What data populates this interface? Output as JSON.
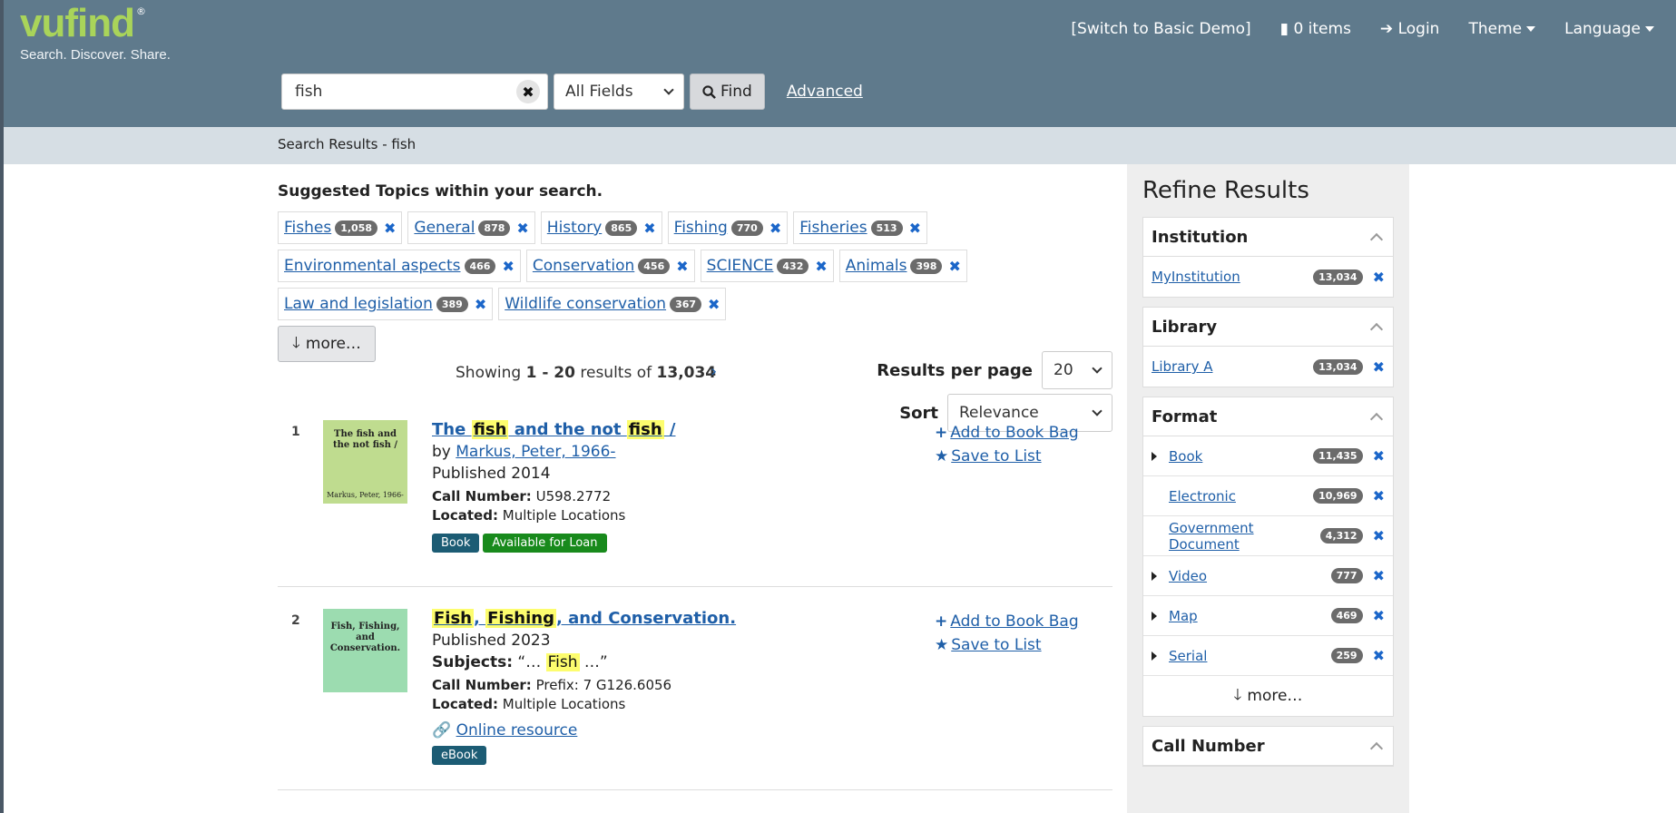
{
  "brand": {
    "logo": "vufind",
    "registered": "®",
    "tagline": "Search. Discover. Share."
  },
  "topnav": {
    "switch_demo": "[Switch to Basic Demo]",
    "bag": "0 items",
    "login": "Login",
    "theme": "Theme",
    "language": "Language"
  },
  "search": {
    "query": "fish",
    "field": "All Fields",
    "find_label": "Find",
    "advanced_label": "Advanced"
  },
  "breadcrumb": "Search Results - fish",
  "suggested": {
    "title": "Suggested Topics within your search.",
    "topics": [
      {
        "label": "Fishes",
        "count": "1,058"
      },
      {
        "label": "General",
        "count": "878"
      },
      {
        "label": "History",
        "count": "865"
      },
      {
        "label": "Fishing",
        "count": "770"
      },
      {
        "label": "Fisheries",
        "count": "513"
      },
      {
        "label": "Environmental aspects",
        "count": "466"
      },
      {
        "label": "Conservation",
        "count": "456"
      },
      {
        "label": "SCIENCE",
        "count": "432"
      },
      {
        "label": "Animals",
        "count": "398"
      },
      {
        "label": "Law and legislation",
        "count": "389"
      },
      {
        "label": "Wildlife conservation",
        "count": "367"
      }
    ],
    "more_label": "more…"
  },
  "results_info": {
    "showing_prefix": "Showing",
    "range": "1 - 20",
    "results_of": "results of",
    "total": "13,034",
    "next_icon": "›",
    "per_page_label": "Results per page",
    "per_page_value": "20",
    "sort_label": "Sort",
    "sort_value": "Relevance"
  },
  "records": [
    {
      "num": "1",
      "thumb_title": "The fish and the not fish /",
      "thumb_author": "Markus, Peter, 1966-",
      "thumb_color": "#bfdc8f",
      "title_parts": [
        "The ",
        "fish",
        " and the not ",
        "fish",
        " /"
      ],
      "by_label": "by",
      "author": "Markus, Peter, 1966-",
      "published": "Published 2014",
      "call_label": "Call Number:",
      "call_number": "U598.2772",
      "located_label": "Located:",
      "located": "Multiple Locations",
      "badges": [
        "Book",
        "Available for Loan"
      ],
      "add_bag": "Add to Book Bag",
      "save_list": "Save to List"
    },
    {
      "num": "2",
      "thumb_title": "Fish, Fishing, and Conservation.",
      "thumb_color": "#9cdcb0",
      "title_parts": [
        "Fish",
        ", ",
        "Fishing",
        ", and Conservation."
      ],
      "published": "Published 2023",
      "subjects_label": "Subjects:",
      "subjects_parts": [
        "“… ",
        "Fish",
        " …”"
      ],
      "call_label": "Call Number:",
      "call_number": "Prefix: 7 G126.6056",
      "located_label": "Located:",
      "located": "Multiple Locations",
      "online": "Online resource",
      "badges": [
        "eBook"
      ],
      "add_bag": "Add to Book Bag",
      "save_list": "Save to List"
    }
  ],
  "sidebar": {
    "title": "Refine Results",
    "institution": {
      "label": "Institution",
      "items": [
        {
          "name": "MyInstitution",
          "count": "13,034"
        }
      ]
    },
    "library": {
      "label": "Library",
      "items": [
        {
          "name": "Library A",
          "count": "13,034"
        }
      ]
    },
    "format": {
      "label": "Format",
      "items": [
        {
          "name": "Book",
          "count": "11,435",
          "expand": true
        },
        {
          "name": "Electronic",
          "count": "10,969",
          "expand": false
        },
        {
          "name": "Government Document",
          "count": "4,312",
          "expand": false
        },
        {
          "name": "Video",
          "count": "777",
          "expand": true
        },
        {
          "name": "Map",
          "count": "469",
          "expand": true
        },
        {
          "name": "Serial",
          "count": "259",
          "expand": true
        }
      ],
      "more_label": "more…"
    },
    "call_number": {
      "label": "Call Number"
    }
  },
  "colors": {
    "header": "#5f7a8c",
    "link": "#1f5fa8",
    "highlight": "#fdfd6e",
    "logo": "#a9d45a"
  }
}
